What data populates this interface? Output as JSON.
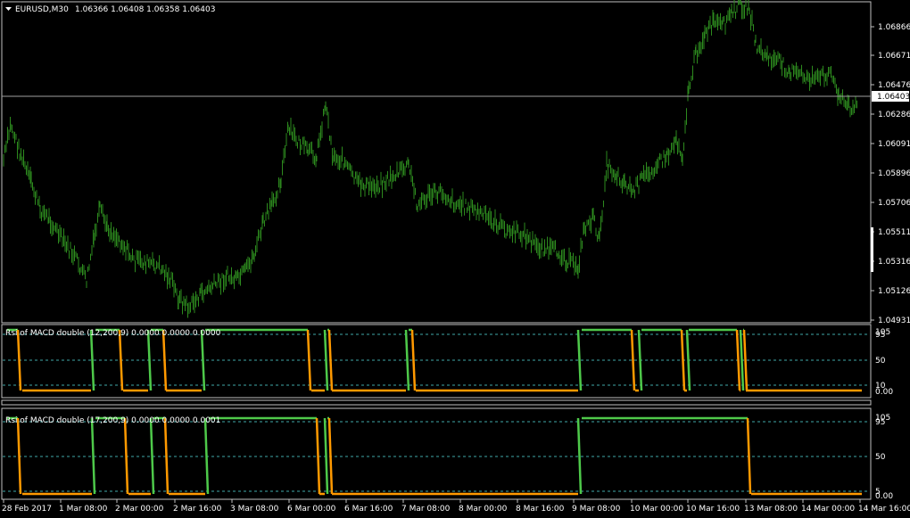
{
  "colors": {
    "background": "#000000",
    "frame": "#c0c0c0",
    "candles": "#2d8a1e",
    "bid_line": "#a0a0a0",
    "indicator_up": "#4ec94a",
    "indicator_down": "#ff9900",
    "level_lines": "#3fa8a8",
    "text": "#ffffff"
  },
  "main": {
    "symbol_label": "EURUSD,M30",
    "ohlc": "1.06366 1.06408 1.06358 1.06403",
    "menu_icon": "triangle-down-icon",
    "price_labels": [
      "1.06866",
      "1.06671",
      "1.06476",
      "1.06286",
      "1.06091",
      "1.05896",
      "1.05706",
      "1.05511",
      "1.05316",
      "1.05126",
      "1.04931"
    ],
    "current_price": "1.06403"
  },
  "indicator1": {
    "title": "Rsi of MACD double (12,200,9) 0.0000 0.0000 0.0000",
    "levels": [
      "105",
      "95",
      "50",
      "10",
      "0.00"
    ]
  },
  "indicator2": {
    "title": "Rsi of MACD double (17,200,9) 0.0000 0.0000 0.0001",
    "levels": [
      "105",
      "95",
      "50",
      "5",
      "0.00"
    ]
  },
  "time_labels": [
    "28 Feb 2017",
    "1 Mar 08:00",
    "2 Mar 00:00",
    "2 Mar 16:00",
    "3 Mar 08:00",
    "6 Mar 00:00",
    "6 Mar 16:00",
    "7 Mar 08:00",
    "8 Mar 00:00",
    "8 Mar 16:00",
    "9 Mar 08:00",
    "10 Mar 00:00",
    "10 Mar 16:00",
    "13 Mar 08:00",
    "14 Mar 00:00",
    "14 Mar 16:00"
  ]
}
